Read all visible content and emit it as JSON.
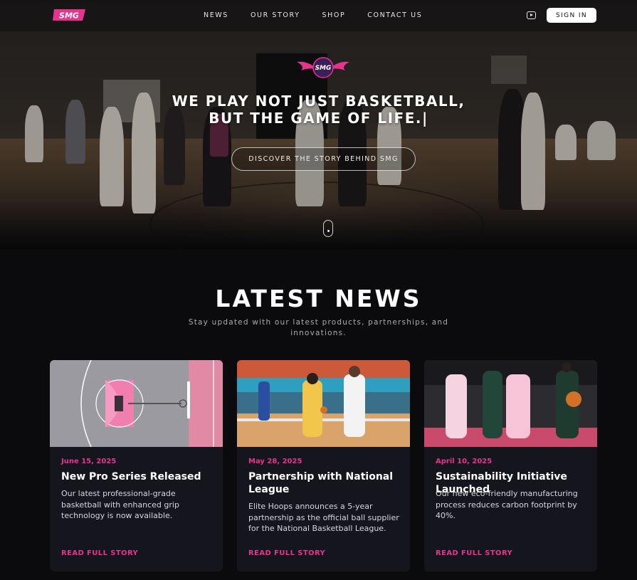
{
  "nav": {
    "logo_text": "SMG",
    "links": [
      {
        "label": "NEWS"
      },
      {
        "label": "OUR STORY"
      },
      {
        "label": "SHOP"
      },
      {
        "label": "CONTACT US"
      }
    ],
    "youtube_icon": "youtube-icon",
    "signin_label": "SIGN IN"
  },
  "hero": {
    "emblem_text": "SMG",
    "title_line1": "WE PLAY NOT JUST BASKETBALL,",
    "title_line2": "BUT THE GAME OF LIFE.|",
    "cta_label": "DISCOVER THE STORY BEHIND SMG"
  },
  "news": {
    "title": "LATEST NEWS",
    "subtitle": "Stay updated with our latest products, partnerships, and innovations.",
    "cards": [
      {
        "date": "June 15, 2025",
        "title": "New Pro Series Released",
        "text": "Our latest professional-grade basketball with enhanced grip technology is now available.",
        "link": "READ FULL STORY"
      },
      {
        "date": "May 28, 2025",
        "title": "Partnership with National League",
        "text": "Elite Hoops announces a 5-year partnership as the official ball supplier for the National Basketball League.",
        "link": "READ FULL STORY"
      },
      {
        "date": "April 10, 2025",
        "title": "Sustainability Initiative Launched",
        "text": "Our new eco-friendly manufacturing process reduces carbon footprint by 40%.",
        "link": "READ FULL STORY"
      }
    ]
  },
  "colors": {
    "accent": "#e6348e",
    "background": "#0b0b0e",
    "card": "#15151d"
  }
}
